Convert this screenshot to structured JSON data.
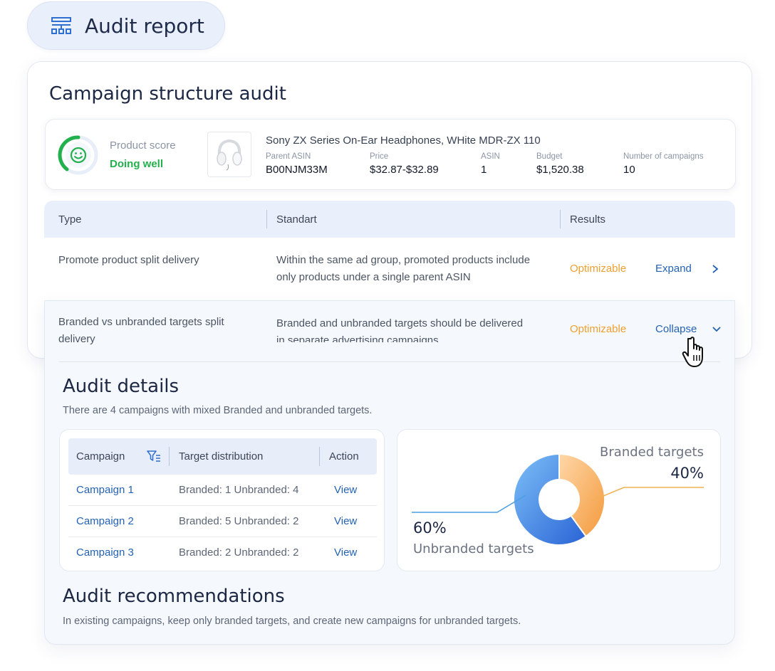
{
  "header": {
    "title": "Audit report",
    "icon": "table-layout-icon"
  },
  "audit": {
    "title": "Campaign structure audit",
    "product": {
      "score_label": "Product score",
      "score_value": "Doing well",
      "name": "Sony ZX Series On-Ear Headphones, WHite MDR-ZX 110",
      "meta": [
        {
          "label": "Parent ASIN",
          "value": "B00NJM33M"
        },
        {
          "label": "Price",
          "value": "$32.87-$32.89"
        },
        {
          "label": "ASIN",
          "value": "1"
        },
        {
          "label": "Budget",
          "value": "$1,520.38"
        },
        {
          "label": "Number of campaigns",
          "value": "10"
        }
      ]
    },
    "table": {
      "headers": [
        "Type",
        "Standart",
        "Results"
      ],
      "rows": [
        {
          "type": "Promote product split delivery",
          "standard_l1": "Within the same ad group, promoted products include",
          "standard_l2": "only products under a single parent ASIN",
          "result": "Optimizable",
          "action": "Expand"
        },
        {
          "type_l1": "Branded vs unbranded targets split",
          "type_l2": "delivery",
          "standard_l1": "Branded and unbranded targets should be delivered",
          "standard_l2": "in separate advertising campaigns",
          "result": "Optimizable",
          "action": "Collapse"
        }
      ]
    }
  },
  "details": {
    "title": "Audit details",
    "note": "There are 4 campaigns with mixed Branded and unbranded targets.",
    "campaign_table": {
      "headers": [
        "Campaign",
        "Target distribution",
        "Action"
      ],
      "rows": [
        {
          "campaign": "Campaign 1",
          "distribution": "Branded: 1 Unbranded: 4",
          "action": "View"
        },
        {
          "campaign": "Campaign 2",
          "distribution": "Branded: 5 Unbranded: 2",
          "action": "View"
        },
        {
          "campaign": "Campaign 3",
          "distribution": "Branded: 2 Unbranded: 2",
          "action": "View"
        }
      ]
    }
  },
  "recommendations": {
    "title": "Audit recommendations",
    "note": "In existing campaigns, keep only branded targets, and create new campaigns for unbranded targets."
  },
  "chart_data": {
    "type": "pie",
    "categories": [
      "Branded targets",
      "Unbranded targets"
    ],
    "values": [
      40,
      60
    ],
    "value_labels": [
      "40%",
      "60%"
    ],
    "colors": [
      "#f7a24a",
      "#3b7fe0"
    ]
  },
  "colors": {
    "accent": "#2462b5",
    "warning": "#f0a030",
    "success": "#22b14c"
  }
}
